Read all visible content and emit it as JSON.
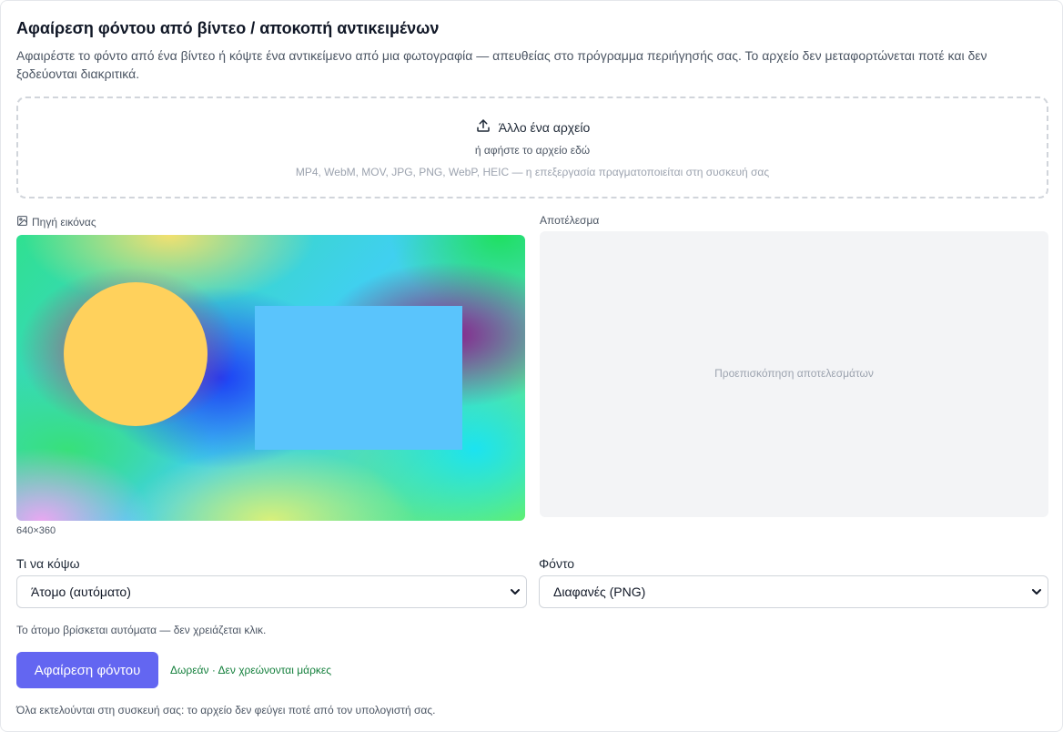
{
  "header": {
    "title": "Αφαίρεση φόντου από βίντεο / αποκοπή αντικειμένων",
    "description": "Αφαιρέστε το φόντο από ένα βίντεο ή κόψτε ένα αντικείμενο από μια φωτογραφία — απευθείας στο πρόγραμμα περιήγησής σας. Το αρχείο δεν μεταφορτώνεται ποτέ και δεν ξοδεύονται διακριτικά."
  },
  "dropzone": {
    "main_label": "Άλλο ένα αρχείο",
    "sub_label": "ή αφήστε το αρχείο εδώ",
    "hint": "MP4, WebM, MOV, JPG, PNG, WebP, HEIC — η επεξεργασία πραγματοποιείται στη συσκευή σας",
    "icon": "upload-icon"
  },
  "source": {
    "label": "Πηγή εικόνας",
    "icon": "image-icon",
    "dimensions": "640×360"
  },
  "result": {
    "label": "Αποτέλεσμα",
    "placeholder": "Προεπισκόπηση αποτελεσμάτων"
  },
  "controls": {
    "cut_label": "Τι να κόψω",
    "cut_value": "Άτομο (αυτόματο)",
    "background_label": "Φόντο",
    "background_value": "Διαφανές (PNG)",
    "auto_note": "Το άτομο βρίσκεται αυτόματα — δεν χρειάζεται κλικ."
  },
  "actions": {
    "remove_label": "Αφαίρεση φόντου",
    "free_note": "Δωρεάν · Δεν χρεώνονται μάρκες",
    "footer_note": "Όλα εκτελούνται στη συσκευή σας: το αρχείο δεν φεύγει ποτέ από τον υπολογιστή σας."
  },
  "colors": {
    "accent": "#6366f1",
    "success_text": "#15803d",
    "circle": "#ffd15c",
    "rect": "#5ac4fc"
  }
}
